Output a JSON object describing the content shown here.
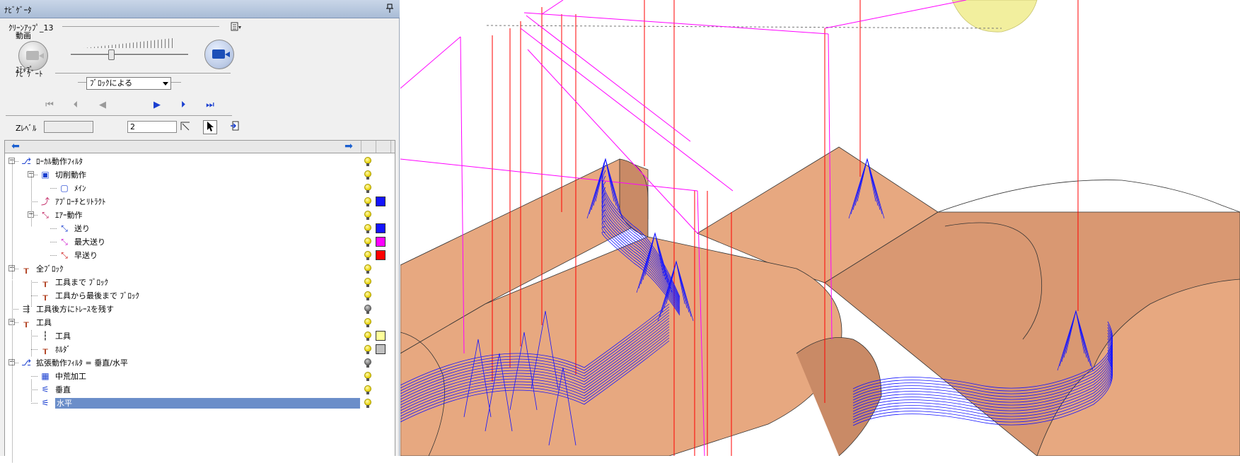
{
  "navigator": {
    "title": "ﾅﾋﾞｹﾞｰﾀ",
    "pin_icon": "pin-icon",
    "toolpath_name": "ｸﾘｰﾝｱｯﾌﾟ_13",
    "animation_label": "動画",
    "step_label": "ｽﾃｯﾌﾟ",
    "navigate_label": "ﾅﾋﾞｹﾞｰﾄ",
    "block_mode_select": "ﾌﾞﾛｯｸによる",
    "z_level_label": "Zﾚﾍﾞﾙ",
    "z_level_value": "",
    "step_value": "2"
  },
  "tree": [
    {
      "label": "ﾛｰｶﾙ動作ﾌｨﾙﾀ",
      "icon": "local-filter-icon",
      "level": 0,
      "expand": "−",
      "bulb": "yellow",
      "swatch": null
    },
    {
      "label": "切削動作",
      "icon": "cut-icon",
      "level": 1,
      "expand": "−",
      "bulb": "yellow",
      "swatch": null
    },
    {
      "label": "ﾒｲﾝ",
      "icon": "main-icon",
      "level": 2,
      "expand": null,
      "bulb": "yellow",
      "swatch": null
    },
    {
      "label": "ｱﾌﾟﾛｰﾁとﾘﾄﾗｸﾄ",
      "icon": "approach-retract-icon",
      "level": 1,
      "expand": null,
      "bulb": "yellow",
      "swatch": "#1414ff"
    },
    {
      "label": "ｴｱｰ動作",
      "icon": "air-move-icon",
      "level": 1,
      "expand": "−",
      "bulb": "yellow",
      "swatch": null
    },
    {
      "label": "送り",
      "icon": "feed-icon",
      "level": 2,
      "expand": null,
      "bulb": "yellow",
      "swatch": "#1414ff"
    },
    {
      "label": "最大送り",
      "icon": "max-feed-icon",
      "level": 2,
      "expand": null,
      "bulb": "yellow",
      "swatch": "#ff00ff"
    },
    {
      "label": "早送り",
      "icon": "rapid-icon",
      "level": 2,
      "expand": null,
      "bulb": "yellow",
      "swatch": "#ff0000"
    },
    {
      "label": "全ﾌﾞﾛｯｸ",
      "icon": "all-blocks-icon",
      "level": 0,
      "expand": "−",
      "bulb": "yellow",
      "swatch": null
    },
    {
      "label": "工具まで ﾌﾞﾛｯｸ",
      "icon": "to-tool-block-icon",
      "level": 1,
      "expand": null,
      "bulb": "yellow",
      "swatch": null
    },
    {
      "label": "工具から最後まで ﾌﾞﾛｯｸ",
      "icon": "from-tool-block-icon",
      "level": 1,
      "expand": null,
      "bulb": "yellow",
      "swatch": null
    },
    {
      "label": "工具後方にﾄﾚｰｽを残す",
      "icon": "trace-icon",
      "level": 0,
      "expand": null,
      "bulb": "gray",
      "swatch": null
    },
    {
      "label": "工具",
      "icon": "tool-icon",
      "level": 0,
      "expand": "−",
      "bulb": "yellow",
      "swatch": null
    },
    {
      "label": "工具",
      "icon": "tool-tip-icon",
      "level": 1,
      "expand": null,
      "bulb": "yellow",
      "swatch": "#ffff99"
    },
    {
      "label": "ﾎﾙﾀﾞ",
      "icon": "holder-icon",
      "level": 1,
      "expand": null,
      "bulb": "yellow",
      "swatch": "#c0c0c0"
    },
    {
      "label": "拡張動作ﾌｨﾙﾀ = 垂直/水平",
      "icon": "extended-filter-icon",
      "level": 0,
      "expand": "−",
      "bulb": "gray",
      "swatch": null
    },
    {
      "label": "中荒加工",
      "icon": "semi-rough-icon",
      "level": 1,
      "expand": null,
      "bulb": "yellow",
      "swatch": null
    },
    {
      "label": "垂直",
      "icon": "vertical-icon",
      "level": 1,
      "expand": null,
      "bulb": "yellow",
      "swatch": null
    },
    {
      "label": "水平",
      "icon": "horizontal-icon",
      "level": 1,
      "expand": null,
      "bulb": "yellow",
      "swatch": null,
      "selected": true
    }
  ],
  "colors": {
    "part_face": "#e7a880",
    "part_side": "#c98a66",
    "toolpath_feed": "#1414ff",
    "toolpath_max_feed": "#ff00ff",
    "toolpath_rapid": "#ff0000",
    "tool": "#f2ef9e"
  }
}
